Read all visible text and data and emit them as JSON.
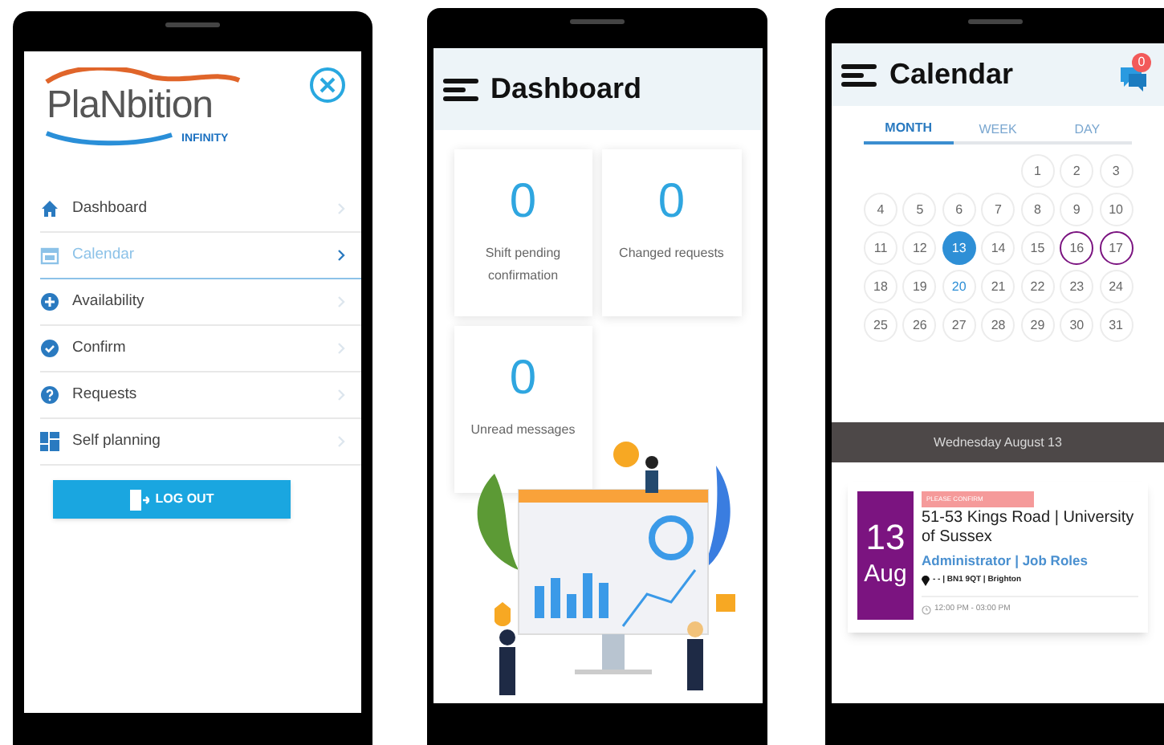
{
  "menu_screen": {
    "logo": {
      "name": "PlaNbition",
      "tagline": "INFINITY"
    },
    "items": [
      {
        "label": "Dashboard",
        "selected": false
      },
      {
        "label": "Calendar",
        "selected": true
      },
      {
        "label": "Availability",
        "selected": false
      },
      {
        "label": "Confirm",
        "selected": false
      },
      {
        "label": "Requests",
        "selected": false
      },
      {
        "label": "Self planning",
        "selected": false
      }
    ],
    "logout_button": "LOG OUT"
  },
  "dashboard_screen": {
    "title": "Dashboard",
    "cards": [
      {
        "value": "0",
        "label": "Shift pending confirmation"
      },
      {
        "value": "0",
        "label": "Changed requests"
      },
      {
        "value": "0",
        "label": "Unread messages"
      }
    ]
  },
  "calendar_screen": {
    "title": "Calendar",
    "message_badge": "0",
    "tabs": [
      {
        "label": "MONTH",
        "selected": true
      },
      {
        "label": "WEEK",
        "selected": false
      },
      {
        "label": "DAY",
        "selected": false
      }
    ],
    "days": [
      {
        "kind": "blank"
      },
      {
        "kind": "blank"
      },
      {
        "kind": "blank"
      },
      {
        "kind": "blank"
      },
      {
        "label": "1",
        "kind": "plain"
      },
      {
        "label": "2",
        "kind": "plain"
      },
      {
        "label": "3",
        "kind": "plain"
      },
      {
        "label": "4",
        "kind": "plain"
      },
      {
        "label": "5",
        "kind": "plain"
      },
      {
        "label": "6",
        "kind": "plain"
      },
      {
        "label": "7",
        "kind": "plain"
      },
      {
        "label": "8",
        "kind": "plain"
      },
      {
        "label": "9",
        "kind": "plain"
      },
      {
        "label": "10",
        "kind": "plain"
      },
      {
        "label": "11",
        "kind": "plain"
      },
      {
        "label": "12",
        "kind": "plain"
      },
      {
        "label": "13",
        "kind": "selected"
      },
      {
        "label": "14",
        "kind": "plain"
      },
      {
        "label": "15",
        "kind": "plain"
      },
      {
        "label": "16",
        "kind": "event"
      },
      {
        "label": "17",
        "kind": "event"
      },
      {
        "label": "18",
        "kind": "plain"
      },
      {
        "label": "19",
        "kind": "plain"
      },
      {
        "label": "20",
        "kind": "today"
      },
      {
        "label": "21",
        "kind": "plain"
      },
      {
        "label": "22",
        "kind": "plain"
      },
      {
        "label": "23",
        "kind": "plain"
      },
      {
        "label": "24",
        "kind": "plain"
      },
      {
        "label": "25",
        "kind": "plain"
      },
      {
        "label": "26",
        "kind": "plain"
      },
      {
        "label": "27",
        "kind": "plain"
      },
      {
        "label": "28",
        "kind": "plain"
      },
      {
        "label": "29",
        "kind": "plain"
      },
      {
        "label": "30",
        "kind": "plain"
      },
      {
        "label": "31",
        "kind": "plain"
      }
    ],
    "day_header": "Wednesday August 13",
    "event": {
      "day": "13",
      "month": "Aug",
      "tag": "PLEASE CONFIRM",
      "title": "51-53 Kings Road | University of Sussex",
      "role": "Administrator | Job Roles",
      "location": "- - | BN1 9QT | Brighton",
      "time": "12:00 PM - 03:00 PM"
    }
  }
}
